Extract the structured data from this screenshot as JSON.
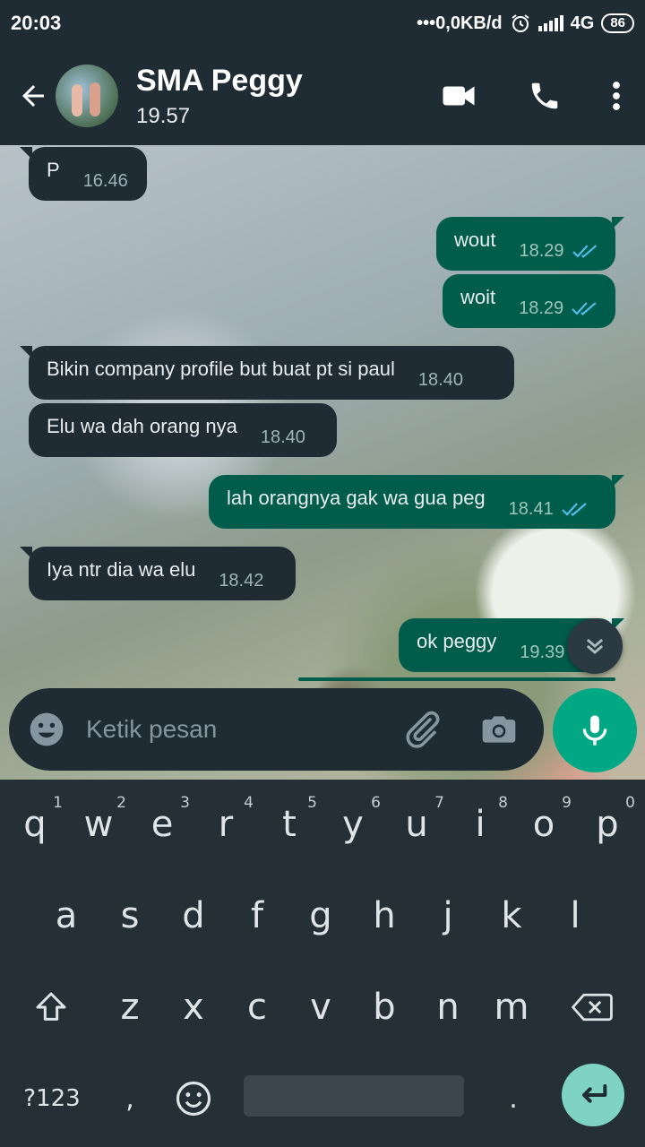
{
  "status_bar": {
    "time": "20:03",
    "network_speed": "•••0,0KB/d",
    "network_type": "4G",
    "battery": "86"
  },
  "header": {
    "contact_name": "SMA Peggy",
    "contact_status": "19.57"
  },
  "messages": [
    {
      "direction": "in",
      "text": "P",
      "time": "16.46"
    },
    {
      "direction": "out",
      "text": "wout",
      "time": "18.29",
      "read": true
    },
    {
      "direction": "out",
      "text": "woit",
      "time": "18.29",
      "read": true
    },
    {
      "direction": "in",
      "text": "Bikin company profile but buat pt si paul",
      "time": "18.40"
    },
    {
      "direction": "in",
      "text": "Elu wa dah orang nya",
      "time": "18.40"
    },
    {
      "direction": "out",
      "text": "lah orangnya gak wa gua peg",
      "time": "18.41",
      "read": true
    },
    {
      "direction": "in",
      "text": "Iya ntr dia wa elu",
      "time": "18.42"
    },
    {
      "direction": "out",
      "text": "ok peggy",
      "time": "19.39",
      "read": true
    }
  ],
  "composer": {
    "placeholder": "Ketik pesan"
  },
  "keyboard": {
    "row1": [
      {
        "key": "q",
        "hint": "1"
      },
      {
        "key": "w",
        "hint": "2"
      },
      {
        "key": "e",
        "hint": "3"
      },
      {
        "key": "r",
        "hint": "4"
      },
      {
        "key": "t",
        "hint": "5"
      },
      {
        "key": "y",
        "hint": "6"
      },
      {
        "key": "u",
        "hint": "7"
      },
      {
        "key": "i",
        "hint": "8"
      },
      {
        "key": "o",
        "hint": "9"
      },
      {
        "key": "p",
        "hint": "0"
      }
    ],
    "row2": [
      "a",
      "s",
      "d",
      "f",
      "g",
      "h",
      "j",
      "k",
      "l"
    ],
    "row3": [
      "z",
      "x",
      "c",
      "v",
      "b",
      "n",
      "m"
    ],
    "symbols_label": "?123",
    "comma": ",",
    "period": "."
  },
  "colors": {
    "app_bg": "#1f2c34",
    "outgoing_bubble": "#005c4b",
    "incoming_bubble": "#1f2c34",
    "accent": "#00a884",
    "read_ticks": "#53bdeb"
  }
}
